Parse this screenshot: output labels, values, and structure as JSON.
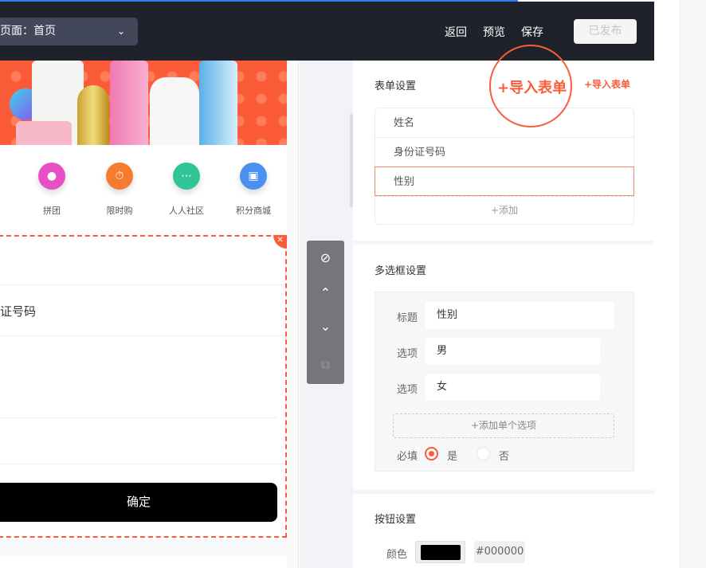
{
  "header": {
    "page_select": "页面：首页",
    "back": "返回",
    "preview": "预览",
    "save": "保存",
    "published": "已发布"
  },
  "preview": {
    "nav_items": [
      {
        "label": "拼团",
        "color": "#e94fc4"
      },
      {
        "label": "限时购",
        "color": "#f57c2e"
      },
      {
        "label": "人人社区",
        "color": "#2fc596"
      },
      {
        "label": "积分商城",
        "color": "#4a90f0"
      }
    ],
    "field_label": "证号码",
    "confirm": "确定"
  },
  "panel": {
    "form_settings": {
      "title": "表单设置",
      "import": "+导入表单",
      "fields": [
        "姓名",
        "身份证号码",
        "性别"
      ],
      "selected": 2,
      "add": "+添加"
    },
    "checkbox_settings": {
      "title": "多选框设置",
      "title_label": "标题",
      "title_value": "性别",
      "option_label": "选项",
      "options": [
        "男",
        "女"
      ],
      "add_option": "+添加单个选项",
      "required_label": "必填",
      "yes": "是",
      "no": "否",
      "required": true
    },
    "button_settings": {
      "title": "按钮设置",
      "color_label": "颜色",
      "color_value": "#000000"
    }
  },
  "colors": {
    "accent": "#fb5b38",
    "topbar": "#1f222b"
  }
}
